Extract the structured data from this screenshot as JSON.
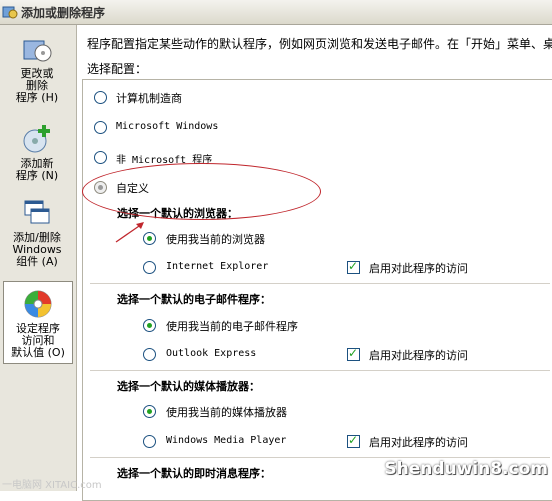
{
  "window": {
    "title": "添加或删除程序"
  },
  "sidebar": {
    "items": [
      {
        "label_lines": [
          "更改或",
          "删除",
          "程序 (H)"
        ]
      },
      {
        "label_lines": [
          "添加新",
          "程序 (N)"
        ]
      },
      {
        "label_lines": [
          "添加/删除",
          "Windows",
          "组件 (A)"
        ]
      },
      {
        "label_lines": [
          "设定程序",
          "访问和",
          "默认值 (O)"
        ]
      }
    ]
  },
  "main": {
    "description": "程序配置指定某些动作的默认程序，例如网页浏览和发送电子邮件。在「开始」菜单、桌",
    "config_label": "选择配置：",
    "configs": [
      {
        "label": "计算机制造商",
        "selected": false
      },
      {
        "label": "Microsoft Windows",
        "selected": false
      },
      {
        "label": "非 Microsoft 程序",
        "selected": false
      },
      {
        "label": "自定义",
        "selected": true
      }
    ],
    "sections": [
      {
        "heading": "选择一个默认的浏览器：",
        "current": "使用我当前的浏览器",
        "program": "Internet Explorer",
        "enable": "启用对此程序的访问"
      },
      {
        "heading": "选择一个默认的电子邮件程序：",
        "current": "使用我当前的电子邮件程序",
        "program": "Outlook Express",
        "enable": "启用对此程序的访问"
      },
      {
        "heading": "选择一个默认的媒体播放器：",
        "current": "使用我当前的媒体播放器",
        "program": "Windows Media Player",
        "enable": "启用对此程序的访问"
      },
      {
        "heading": "选择一个默认的即时消息程序："
      }
    ]
  },
  "watermark": {
    "text": "Shenduwin8.com",
    "small": "一电脑网 XITAIC.com"
  },
  "colors": {
    "annotation": "#c0272d",
    "radio_fill": "#21a121"
  }
}
